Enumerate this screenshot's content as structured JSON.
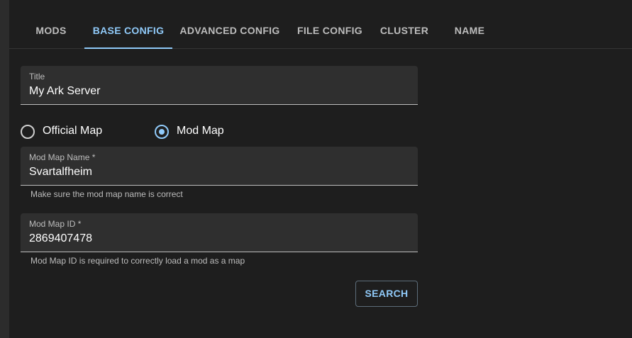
{
  "tabs": [
    {
      "label": "MODS"
    },
    {
      "label": "BASE CONFIG"
    },
    {
      "label": "ADVANCED CONFIG"
    },
    {
      "label": "FILE CONFIG"
    },
    {
      "label": "CLUSTER"
    },
    {
      "label": "NAME"
    }
  ],
  "active_tab": "BASE CONFIG",
  "form": {
    "title": {
      "label": "Title",
      "value": "My Ark Server"
    },
    "map_type": {
      "options": [
        {
          "label": "Official Map",
          "checked": false
        },
        {
          "label": "Mod Map",
          "checked": true
        }
      ]
    },
    "mod_map_name": {
      "label": "Mod Map Name *",
      "value": "Svartalfheim",
      "helper": "Make sure the mod map name is correct"
    },
    "mod_map_id": {
      "label": "Mod Map ID *",
      "value": "2869407478",
      "helper": "Mod Map ID is required to correctly load a mod as a map"
    },
    "search_label": "SEARCH"
  },
  "colors": {
    "accent": "#90caf9",
    "background": "#1e1e1e",
    "field_background": "#2f2f2f"
  }
}
